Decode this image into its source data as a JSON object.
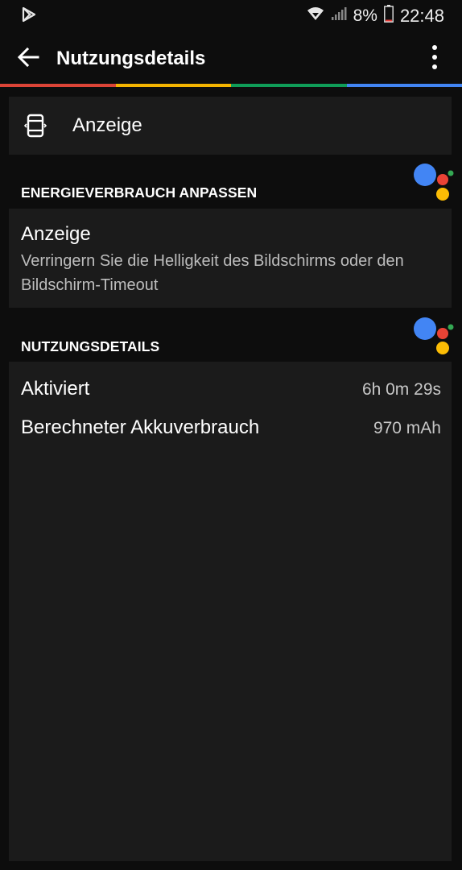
{
  "status_bar": {
    "battery_percent": "8%",
    "time": "22:48",
    "icons": [
      "play-store-icon",
      "wifi-icon",
      "signal-icon",
      "battery-icon"
    ]
  },
  "app_bar": {
    "title": "Nutzungsdetails",
    "back_icon": "arrow-back-icon",
    "menu_icon": "more-vert-icon"
  },
  "accent_colors": [
    "#db4437",
    "#f4b400",
    "#0f9d58",
    "#4285f4"
  ],
  "top_item": {
    "icon": "display-icon",
    "label": "Anzeige"
  },
  "energy_section": {
    "header": "ENERGIEVERBRAUCH ANPASSEN",
    "item_title": "Anzeige",
    "item_description": "Verringern Sie die Helligkeit des Bildschirms oder den Bildschirm-Timeout"
  },
  "usage_section": {
    "header": "NUTZUNGSDETAILS",
    "rows": [
      {
        "label": "Aktiviert",
        "value": "6h 0m 29s"
      },
      {
        "label": "Berechneter Akkuverbrauch",
        "value": "970 mAh"
      }
    ]
  }
}
